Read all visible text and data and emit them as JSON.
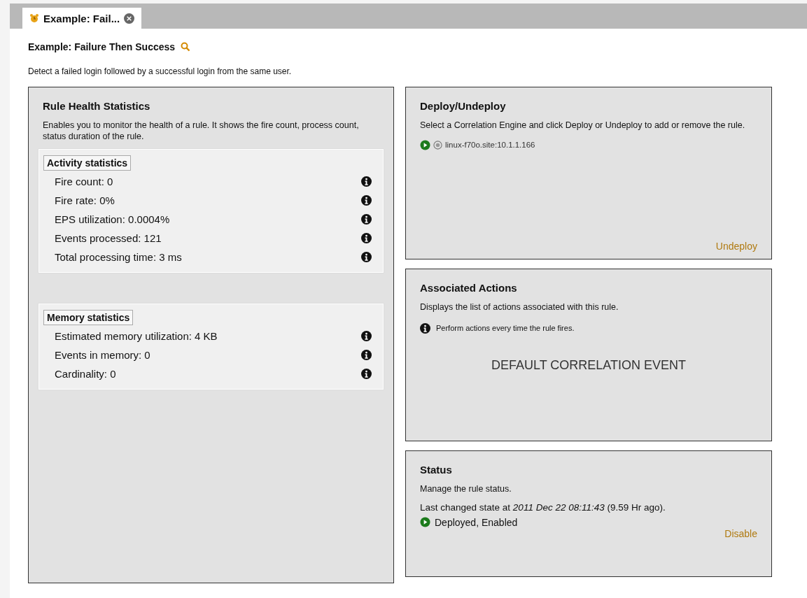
{
  "tabs": [
    {
      "label": "Example: Fail...",
      "selected": true
    }
  ],
  "header": {
    "title": "Example: Failure Then Success",
    "description": "Detect a failed login followed by a successful login from the same user."
  },
  "health": {
    "title": "Rule Health Statistics",
    "description": "Enables you to monitor the health of a rule. It shows the fire count, process count, status duration of the rule.",
    "groups": [
      {
        "title": "Activity statistics",
        "items": [
          "Fire count: 0",
          "Fire rate: 0%",
          "EPS utilization: 0.0004%",
          "Events processed: 121",
          "Total processing time: 3 ms"
        ]
      },
      {
        "title": "Memory statistics",
        "items": [
          "Estimated memory utilization: 4 KB",
          "Events in memory: 0",
          "Cardinality: 0"
        ]
      }
    ]
  },
  "deploy": {
    "title": "Deploy/Undeploy",
    "description": "Select a Correlation Engine and click Deploy or Undeploy to add or remove the rule.",
    "engines": [
      {
        "name": "linux-f70o.site:10.1.1.166",
        "deployed": true
      }
    ],
    "action": "Undeploy"
  },
  "actions": {
    "title": "Associated Actions",
    "description": "Displays the list of actions associated with this rule.",
    "note": "Perform actions every time the rule fires.",
    "event": "DEFAULT CORRELATION EVENT"
  },
  "status": {
    "title": "Status",
    "description": "Manage the rule status.",
    "changed": "Last changed state at *2011 Dec 22 08:11:43* (9.59 Hr ago).",
    "state": "Deployed, Enabled",
    "enabled": true,
    "action": "Disable"
  }
}
